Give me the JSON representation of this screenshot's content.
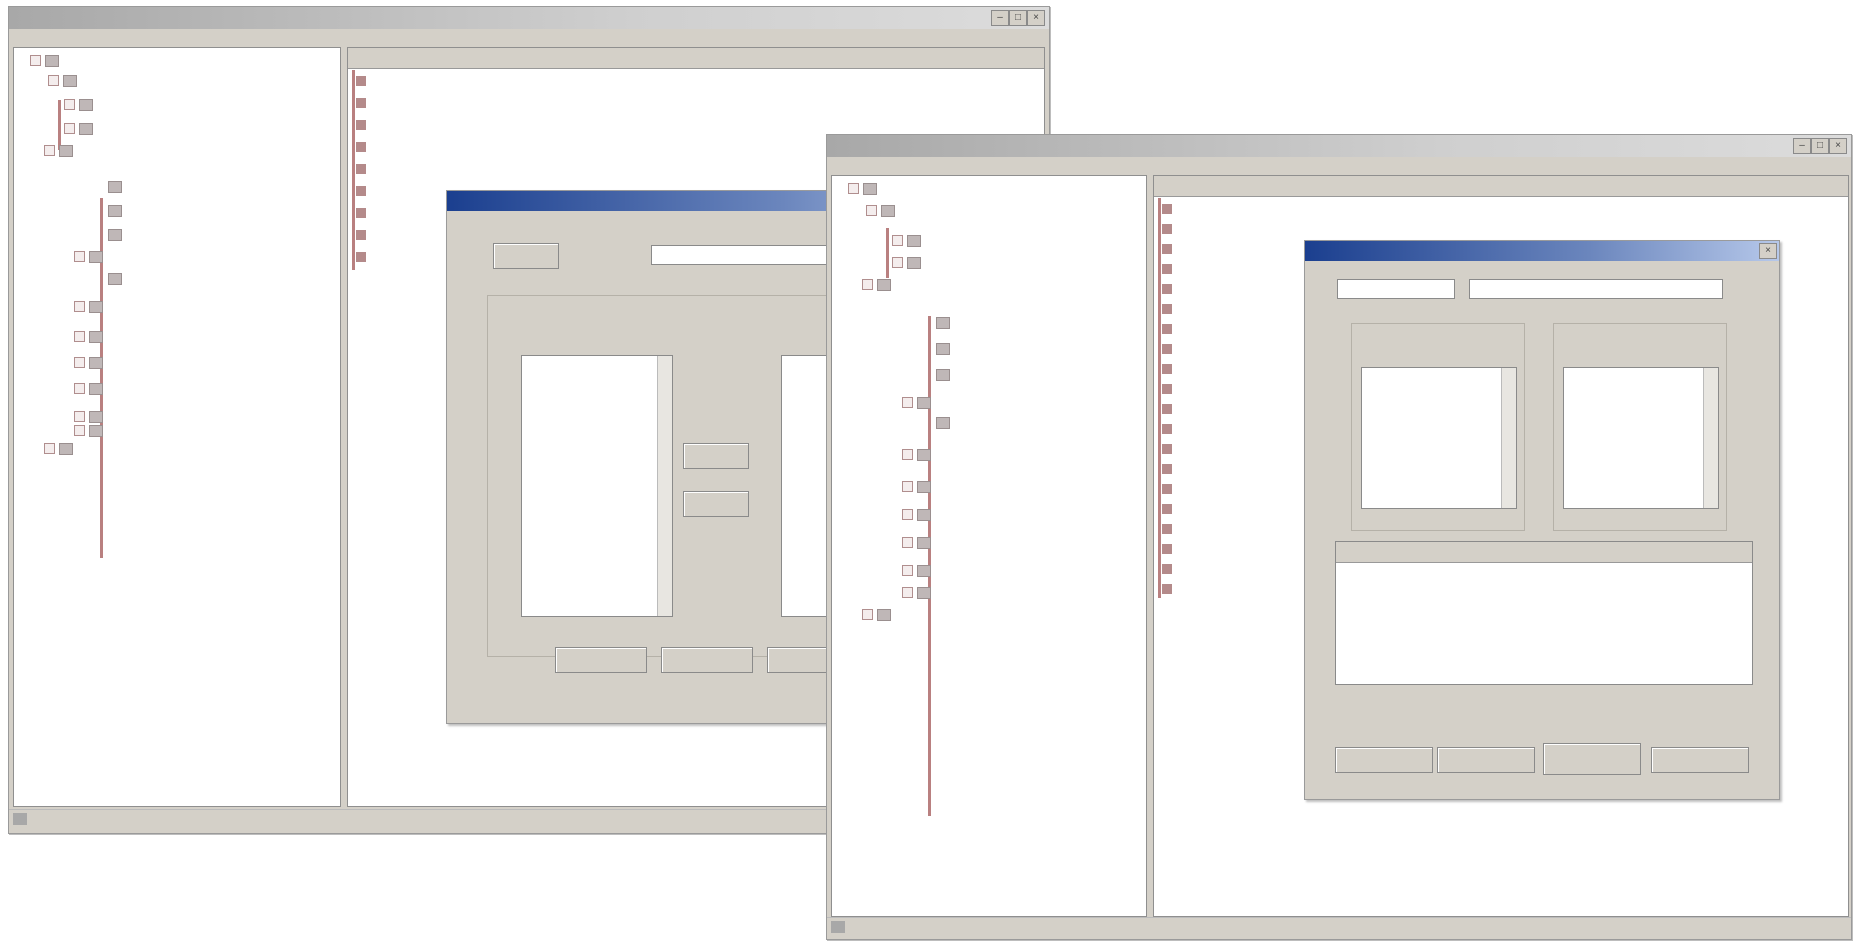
{
  "colors": {
    "tree_line": "#b98080",
    "dialog_title_start": "#1b3f8f",
    "dialog_title_end": "#b6c8ea"
  },
  "window1": {
    "title": "",
    "menu": [
      "",
      "",
      ""
    ],
    "list_columns": [
      "",
      "",
      ""
    ],
    "tree": [
      "",
      "",
      "",
      "",
      "",
      "",
      "",
      "",
      "",
      "",
      "",
      "",
      "",
      "",
      "",
      "",
      ""
    ],
    "list": [
      "",
      "",
      "",
      "",
      "",
      "",
      "",
      "",
      ""
    ],
    "dialog": {
      "title": "",
      "button_a": "",
      "field": "",
      "group_label": "",
      "list_header_left": "",
      "list_header_right": "",
      "list_left": [
        "",
        "",
        "",
        "",
        "",
        "",
        "",
        "",
        ""
      ],
      "mid_btn1": "",
      "mid_btn2": "",
      "bottom_buttons": [
        "",
        "",
        ""
      ]
    }
  },
  "window2": {
    "title": "",
    "menu": [
      "",
      "",
      ""
    ],
    "list_columns": [
      "",
      "",
      ""
    ],
    "tree": [
      "",
      "",
      "",
      "",
      "",
      "",
      "",
      "",
      "",
      "",
      "",
      "",
      "",
      "",
      "",
      "",
      ""
    ],
    "list": [
      "",
      "",
      "",
      "",
      "",
      "",
      "",
      "",
      "",
      "",
      "",
      "",
      "",
      "",
      "",
      "",
      "",
      "",
      "",
      ""
    ],
    "dialog": {
      "title": "",
      "combo": "",
      "field": "",
      "left_group_label": "",
      "left_group_sub": "",
      "right_group_label": "",
      "right_group_sub": "",
      "left_list": [
        "",
        "",
        "",
        "",
        "",
        ""
      ],
      "right_list": [
        "",
        "",
        "",
        "",
        ""
      ],
      "table_headers": [
        "",
        ""
      ],
      "table_rows": [
        [
          "",
          ""
        ],
        [
          "",
          ""
        ]
      ],
      "buttons": [
        "",
        "",
        "",
        ""
      ]
    }
  }
}
